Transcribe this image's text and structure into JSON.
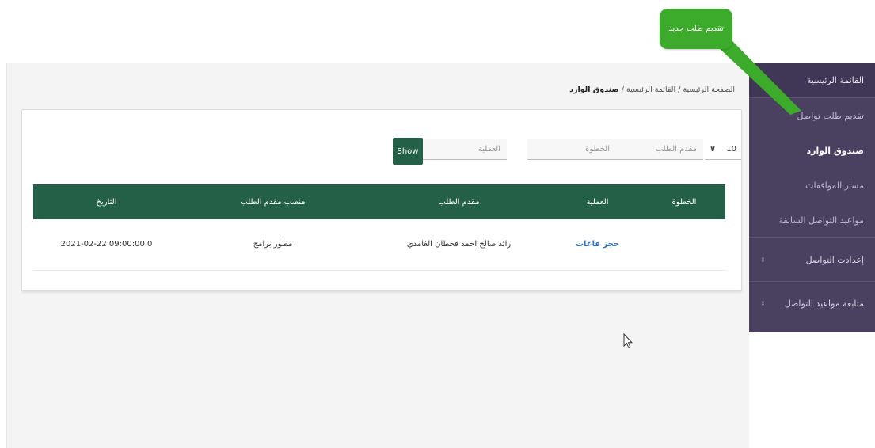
{
  "breadcrumb": {
    "home": "الصفحة الرئيسية",
    "sep1": " / ",
    "menu": "القائمة الرئيسية",
    "sep2": " / ",
    "current": "صندوق الوارد"
  },
  "filters": {
    "page_size": "10",
    "applicant_placeholder": "مقدم الطلب",
    "step_placeholder": "الخطوة",
    "operation_placeholder": "العملية",
    "show_label": "Show"
  },
  "table": {
    "headers": [
      "الخطوة",
      "العملية",
      "مقدم الطلب",
      "منصب مقدم الطلب",
      "التاريخ"
    ],
    "rows": [
      {
        "step": "",
        "operation": "حجز قاعات",
        "applicant": "رائد صالح احمد قحطان الغامدي",
        "position": "مطور برامج",
        "date": "2021-02-22 09:00:00.0"
      }
    ]
  },
  "sidebar": {
    "main_menu": "القائمة الرئيسية",
    "items": [
      "تقديم طلب تواصل",
      "صندوق الوارد",
      "مسار الموافقات",
      "مواعيد التواصل السابقة"
    ],
    "groups": [
      "إعدادت التواصل",
      "متابعة مواعيد التواصل"
    ]
  },
  "callout": {
    "text": "تقديم طلب جديد"
  },
  "colors": {
    "accent": "#246048",
    "sidebar": "#4a4161",
    "callout": "#3cab2c",
    "link": "#2f75c6"
  }
}
